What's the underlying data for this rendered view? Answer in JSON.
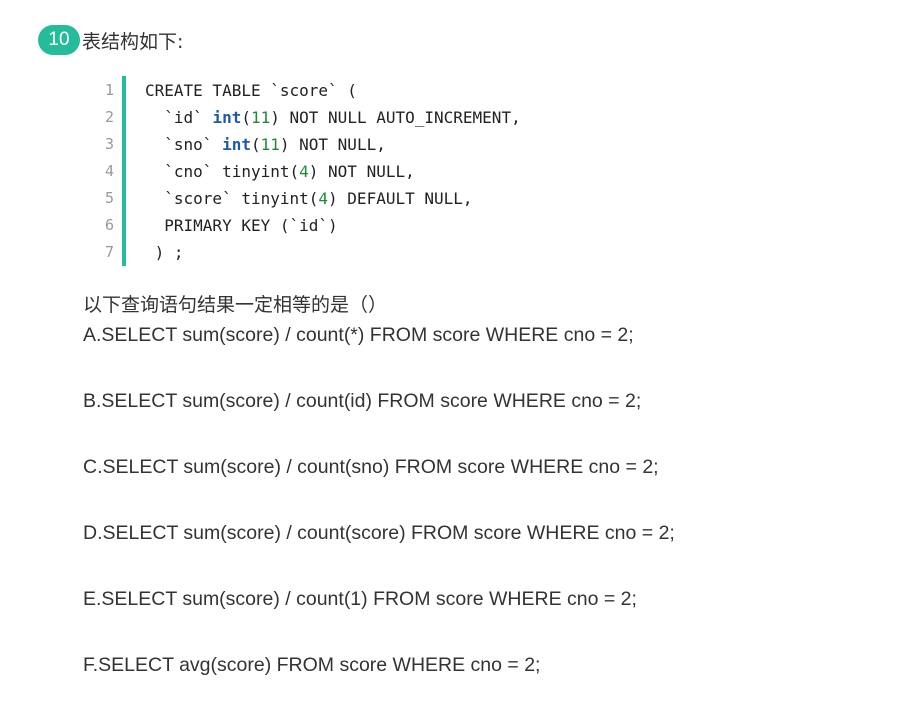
{
  "question": {
    "number": "10",
    "title": "表结构如下:"
  },
  "code": {
    "line_numbers": [
      "1",
      "2",
      "3",
      "4",
      "5",
      "6",
      "7"
    ],
    "lines": [
      [
        "CREATE TABLE `score` ("
      ],
      [
        "  `id` ",
        "int",
        "(",
        "11",
        ") NOT NULL AUTO_INCREMENT,"
      ],
      [
        "  `sno` ",
        "int",
        "(",
        "11",
        ") NOT NULL,"
      ],
      [
        "  `cno` tinyint(",
        "4",
        ") NOT NULL,"
      ],
      [
        "  `score` tinyint(",
        "4",
        ") DEFAULT NULL,"
      ],
      [
        "  PRIMARY KEY (`id`)"
      ],
      [
        " ) ;"
      ]
    ]
  },
  "prompt": "以下查询语句结果一定相等的是（）",
  "options": [
    "A.SELECT sum(score) / count(*) FROM score WHERE cno = 2;",
    "B.SELECT sum(score) / count(id) FROM score WHERE cno = 2;",
    "C.SELECT sum(score) / count(sno) FROM score WHERE cno = 2;",
    "D.SELECT sum(score) / count(score) FROM score WHERE cno = 2;",
    "E.SELECT sum(score) / count(1) FROM score WHERE cno = 2;",
    "F.SELECT avg(score) FROM score WHERE cno = 2;"
  ],
  "colors": {
    "accent": "#25bb9b",
    "type_keyword": "#1f5aa6",
    "number_literal": "#1d8a3a"
  }
}
